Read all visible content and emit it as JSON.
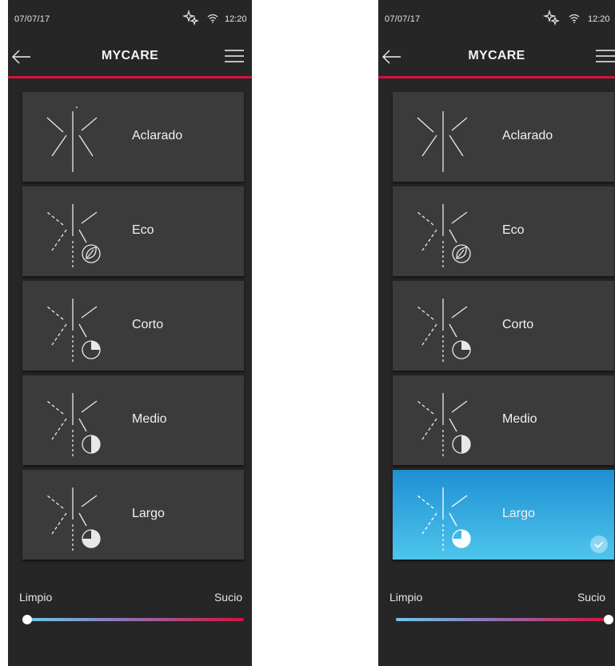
{
  "screens": [
    {
      "status": {
        "date": "07/07/17",
        "time": "12:20"
      },
      "header": {
        "title": "MYCARE"
      },
      "programs": [
        {
          "label": "Aclarado",
          "icon": "rinse-icon"
        },
        {
          "label": "Eco",
          "icon": "eco-leaf-icon"
        },
        {
          "label": "Corto",
          "icon": "clock-quarter-icon"
        },
        {
          "label": "Medio",
          "icon": "clock-half-icon"
        },
        {
          "label": "Largo",
          "icon": "clock-three-quarter-icon"
        }
      ],
      "selected_program": null,
      "soil_slider": {
        "min_label": "Limpio",
        "max_label": "Sucio",
        "value": 0.0
      }
    },
    {
      "status": {
        "date": "07/07/17",
        "time": "12:20"
      },
      "header": {
        "title": "MYCARE"
      },
      "programs": [
        {
          "label": "Aclarado",
          "icon": "rinse-icon"
        },
        {
          "label": "Eco",
          "icon": "eco-leaf-icon"
        },
        {
          "label": "Corto",
          "icon": "clock-quarter-icon"
        },
        {
          "label": "Medio",
          "icon": "clock-half-icon"
        },
        {
          "label": "Largo",
          "icon": "clock-three-quarter-icon"
        }
      ],
      "selected_program": "Largo",
      "soil_slider": {
        "min_label": "Limpio",
        "max_label": "Sucio",
        "value": 1.0
      }
    }
  ],
  "colors": {
    "background": "#262626",
    "card": "#3b3b3b",
    "accent_red": "#d4123c",
    "selected_gradient_top": "#1f8fd3",
    "selected_gradient_bottom": "#4ec5ec"
  }
}
